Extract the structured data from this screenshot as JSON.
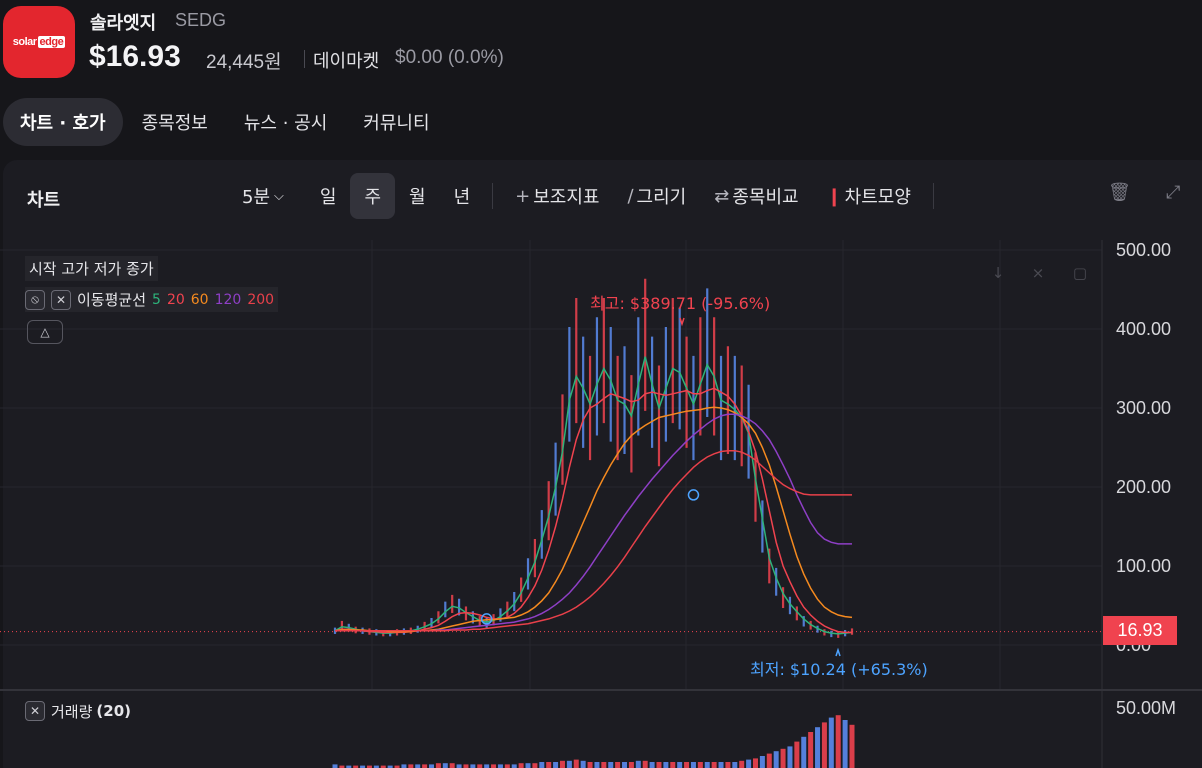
{
  "header": {
    "logo_text_a": "solar",
    "logo_text_b": "edge",
    "name": "솔라엣지",
    "ticker": "SEDG",
    "price": "$16.93",
    "krw": "24,445원",
    "market_label": "데이마켓",
    "change": "$0.00 (0.0%)"
  },
  "tabs": [
    {
      "label": "차트 · 호가",
      "active": true
    },
    {
      "label": "종목정보"
    },
    {
      "label": "뉴스 · 공시"
    },
    {
      "label": "커뮤니티"
    }
  ],
  "panel": {
    "title": "차트",
    "interval": "5분",
    "periods": [
      "일",
      "주",
      "월",
      "년"
    ],
    "selected_period": "주",
    "tools": [
      "보조지표",
      "그리기",
      "종목비교",
      "차트모양"
    ]
  },
  "legend": {
    "ohlc": "시작  고가  저가  종가",
    "ma_label": "이동평균선",
    "ma": [
      {
        "p": "5",
        "color": "#2db37a"
      },
      {
        "p": "20",
        "color": "#f0434f"
      },
      {
        "p": "60",
        "color": "#f58a1f"
      },
      {
        "p": "120",
        "color": "#8e3fc6"
      },
      {
        "p": "200",
        "color": "#e8404a"
      }
    ],
    "volume": "거래량",
    "volume_period": "(20)"
  },
  "annotations": {
    "high": "최고: $389.71 (-95.6%)",
    "low": "최저: $10.24 (+65.3%)"
  },
  "chart_data": {
    "type": "line",
    "title": "",
    "ylim": [
      0,
      500
    ],
    "yticks": [
      "500.00",
      "400.00",
      "300.00",
      "200.00",
      "100.00",
      "0.00"
    ],
    "volume_tick": "50.00M",
    "last_price_tag": "16.93",
    "series": [
      {
        "name": "종가",
        "color": "#6f8cf0",
        "values": [
          18,
          25,
          22,
          19,
          18,
          17,
          16,
          15,
          15,
          16,
          17,
          18,
          20,
          24,
          28,
          35,
          45,
          52,
          48,
          40,
          35,
          30,
          28,
          32,
          38,
          45,
          55,
          70,
          90,
          110,
          140,
          170,
          210,
          260,
          330,
          360,
          320,
          300,
          340,
          360,
          330,
          300,
          310,
          280,
          340,
          380,
          320,
          290,
          330,
          360,
          350,
          320,
          300,
          340,
          370,
          340,
          300,
          310,
          300,
          290,
          270,
          200,
          150,
          100,
          80,
          60,
          50,
          40,
          30,
          25,
          20,
          16,
          14,
          13,
          15,
          17
        ]
      },
      {
        "name": "5",
        "color": "#2db37a",
        "values": [
          18,
          23,
          22,
          20,
          18,
          17,
          16,
          15,
          15,
          16,
          17,
          18,
          20,
          23,
          27,
          33,
          42,
          49,
          47,
          41,
          36,
          31,
          29,
          31,
          36,
          43,
          52,
          66,
          85,
          105,
          133,
          163,
          200,
          245,
          310,
          340,
          325,
          305,
          330,
          350,
          335,
          310,
          305,
          290,
          330,
          365,
          330,
          300,
          325,
          350,
          345,
          325,
          305,
          330,
          355,
          340,
          310,
          305,
          298,
          288,
          268,
          210,
          160,
          110,
          85,
          65,
          52,
          42,
          33,
          26,
          21,
          17,
          15,
          14,
          15,
          16
        ]
      },
      {
        "name": "20",
        "color": "#f0434f",
        "values": [
          18,
          20,
          20,
          19,
          18,
          17,
          17,
          16,
          16,
          16,
          16,
          17,
          18,
          20,
          22,
          25,
          30,
          36,
          40,
          41,
          40,
          38,
          35,
          33,
          33,
          35,
          40,
          48,
          60,
          75,
          95,
          120,
          150,
          185,
          225,
          260,
          285,
          300,
          305,
          312,
          318,
          315,
          312,
          308,
          310,
          318,
          320,
          318,
          316,
          318,
          320,
          322,
          318,
          318,
          322,
          325,
          320,
          315,
          305,
          290,
          270,
          245,
          210,
          170,
          130,
          100,
          80,
          62,
          48,
          38,
          30,
          24,
          20,
          17,
          16,
          16
        ]
      },
      {
        "name": "60",
        "color": "#f58a1f",
        "values": [
          18,
          19,
          19,
          19,
          19,
          18,
          18,
          18,
          17,
          17,
          17,
          17,
          18,
          18,
          19,
          20,
          22,
          24,
          26,
          28,
          30,
          31,
          32,
          32,
          33,
          34,
          35,
          38,
          42,
          48,
          56,
          66,
          80,
          96,
          115,
          135,
          155,
          175,
          195,
          212,
          228,
          242,
          255,
          265,
          272,
          278,
          283,
          288,
          290,
          292,
          294,
          296,
          297,
          298,
          300,
          301,
          300,
          298,
          294,
          288,
          280,
          268,
          250,
          228,
          200,
          170,
          140,
          112,
          90,
          72,
          58,
          48,
          42,
          38,
          36,
          35
        ]
      },
      {
        "name": "120",
        "color": "#8e3fc6",
        "values": [
          18,
          18,
          18,
          18,
          18,
          18,
          18,
          18,
          18,
          18,
          18,
          18,
          18,
          18,
          18,
          19,
          19,
          20,
          21,
          22,
          23,
          24,
          25,
          26,
          27,
          28,
          29,
          31,
          33,
          36,
          40,
          45,
          51,
          58,
          66,
          76,
          87,
          99,
          112,
          125,
          138,
          151,
          164,
          176,
          188,
          199,
          210,
          220,
          230,
          240,
          249,
          258,
          266,
          273,
          280,
          286,
          290,
          292,
          292,
          290,
          286,
          280,
          271,
          260,
          245,
          228,
          210,
          190,
          172,
          155,
          142,
          134,
          130,
          128,
          128,
          128
        ]
      },
      {
        "name": "200",
        "color": "#e8404a",
        "values": [
          18,
          18,
          18,
          18,
          18,
          18,
          18,
          18,
          18,
          18,
          18,
          18,
          18,
          18,
          18,
          18,
          18,
          19,
          19,
          19,
          20,
          20,
          21,
          22,
          23,
          24,
          25,
          26,
          27,
          29,
          31,
          33,
          36,
          39,
          43,
          48,
          54,
          61,
          69,
          78,
          88,
          99,
          111,
          124,
          137,
          150,
          162,
          174,
          186,
          197,
          207,
          216,
          225,
          232,
          238,
          242,
          245,
          246,
          246,
          244,
          240,
          234,
          226,
          218,
          210,
          203,
          198,
          194,
          191,
          190,
          190,
          190,
          190,
          190,
          190,
          190
        ]
      }
    ],
    "volume_values": [
      3,
      2,
      2,
      2,
      2,
      2,
      2,
      2,
      2,
      2,
      3,
      3,
      3,
      3,
      3,
      4,
      4,
      4,
      3,
      3,
      3,
      3,
      3,
      3,
      3,
      3,
      3,
      4,
      4,
      4,
      5,
      5,
      5,
      6,
      6,
      7,
      6,
      5,
      5,
      5,
      5,
      5,
      5,
      5,
      6,
      6,
      5,
      5,
      5,
      5,
      5,
      5,
      5,
      5,
      5,
      5,
      5,
      5,
      5,
      6,
      7,
      8,
      10,
      12,
      14,
      16,
      18,
      22,
      26,
      30,
      34,
      38,
      42,
      44,
      40,
      36
    ]
  }
}
